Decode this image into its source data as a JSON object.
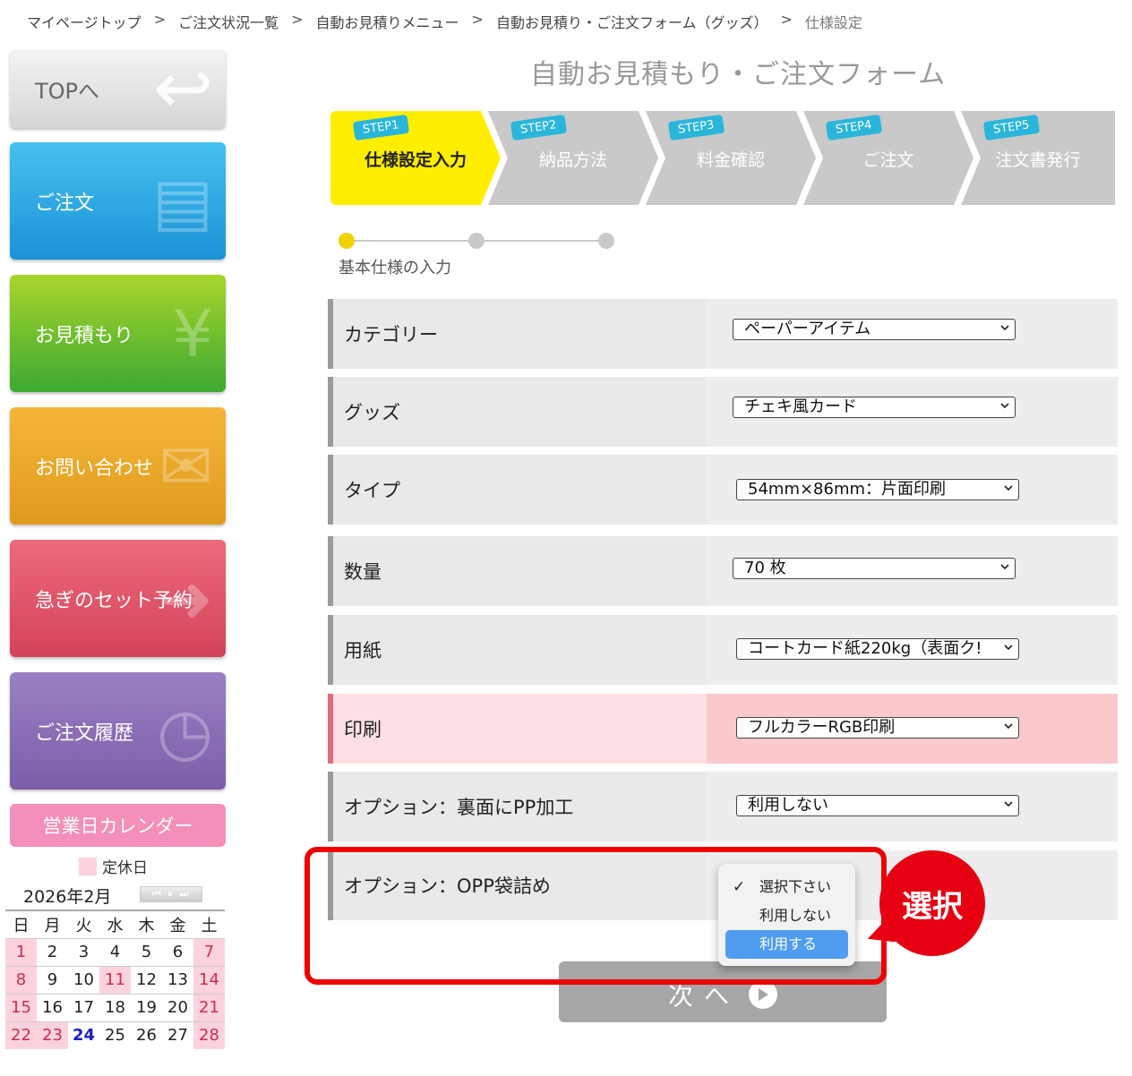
{
  "breadcrumb": [
    {
      "label": "マイページトップ"
    },
    {
      "label": "ご注文状況一覧"
    },
    {
      "label": "自動お見積りメニュー"
    },
    {
      "label": "自動お見積り・ご注文フォーム（グッズ）"
    },
    {
      "label": "仕様設定"
    }
  ],
  "breadcrumb_sep": ">",
  "sidebar": {
    "top": "TOPへ",
    "order": "ご注文",
    "quote": "お見積もり",
    "contact": "お問い合わせ",
    "rush": "急ぎのセット予約",
    "history": "ご注文履歴"
  },
  "calendar": {
    "header": "営業日カレンダー",
    "legend": "定休日",
    "month": "2026年2月",
    "weekdays": [
      "日",
      "月",
      "火",
      "水",
      "木",
      "金",
      "土"
    ],
    "weeks": [
      [
        {
          "d": "1",
          "h": true
        },
        {
          "d": "2"
        },
        {
          "d": "3"
        },
        {
          "d": "4"
        },
        {
          "d": "5"
        },
        {
          "d": "6"
        },
        {
          "d": "7",
          "h": true
        }
      ],
      [
        {
          "d": "8",
          "h": true
        },
        {
          "d": "9"
        },
        {
          "d": "10"
        },
        {
          "d": "11",
          "h": true
        },
        {
          "d": "12"
        },
        {
          "d": "13"
        },
        {
          "d": "14",
          "h": true
        }
      ],
      [
        {
          "d": "15",
          "h": true
        },
        {
          "d": "16"
        },
        {
          "d": "17"
        },
        {
          "d": "18"
        },
        {
          "d": "19"
        },
        {
          "d": "20"
        },
        {
          "d": "21",
          "h": true
        }
      ],
      [
        {
          "d": "22",
          "h": true
        },
        {
          "d": "23",
          "h": true
        },
        {
          "d": "24",
          "t": true
        },
        {
          "d": "25"
        },
        {
          "d": "26"
        },
        {
          "d": "27"
        },
        {
          "d": "28",
          "h": true
        }
      ]
    ]
  },
  "form_title": "自動お見積もり・ご注文フォーム",
  "steps": [
    {
      "tag": "STEP1",
      "name": "仕様設定入力"
    },
    {
      "tag": "STEP2",
      "name": "納品方法"
    },
    {
      "tag": "STEP3",
      "name": "料金確認"
    },
    {
      "tag": "STEP4",
      "name": "ご注文"
    },
    {
      "tag": "STEP5",
      "name": "注文書発行"
    }
  ],
  "progress_label": "基本仕様の入力",
  "rows": {
    "category": {
      "label": "カテゴリー",
      "value": "ペーパーアイテム"
    },
    "goods": {
      "label": "グッズ",
      "value": "チェキ風カード"
    },
    "type": {
      "label": "タイプ",
      "value": "54mm×86mm：片面印刷"
    },
    "qty": {
      "label": "数量",
      "value": "70 枚"
    },
    "paper": {
      "label": "用紙",
      "value": "コートカード紙220kg（表面ク!"
    },
    "print": {
      "label": "印刷",
      "value": "フルカラーRGB印刷"
    },
    "pp": {
      "label": "オプション：裏面にPP加工",
      "value": "利用しない"
    },
    "opp": {
      "label": "オプション：OPP袋詰め"
    }
  },
  "dropdown": {
    "options": [
      "選択下さい",
      "利用しない",
      "利用する"
    ],
    "check": "✓"
  },
  "next_button": "次へ",
  "callout": "選択",
  "colors": {
    "step_active": "#ffee00",
    "step_tag": "#2ab6da",
    "highlight": "#ee0000",
    "hover": "#4f9cf0"
  }
}
